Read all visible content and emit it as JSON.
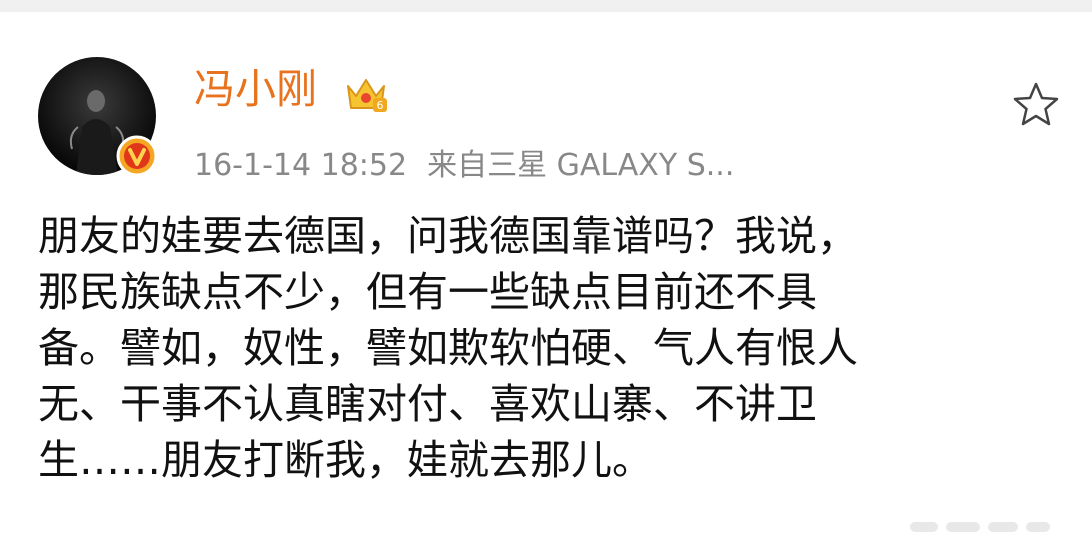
{
  "post": {
    "author": {
      "name": "冯小刚",
      "avatar_icon": "avatar-photo",
      "badge_icon": "verified-v-icon",
      "vip_icon": "crown-level-6-icon",
      "accent_color": "#e8731e"
    },
    "timestamp": "16-1-14 18:52",
    "source": "来自三星 GALAXY S...",
    "favorite_icon": "star-outline-icon",
    "text_lines": [
      "朋友的娃要去德国，问我德国靠谱吗？我说，",
      "那民族缺点不少，但有一些缺点目前还不具",
      "备。譬如，奴性，譬如欺软怕硬、气人有恨人",
      "无、干事不认真瞎对付、喜欢山寨、不讲卫",
      "生……朋友打断我，娃就去那儿。"
    ]
  }
}
